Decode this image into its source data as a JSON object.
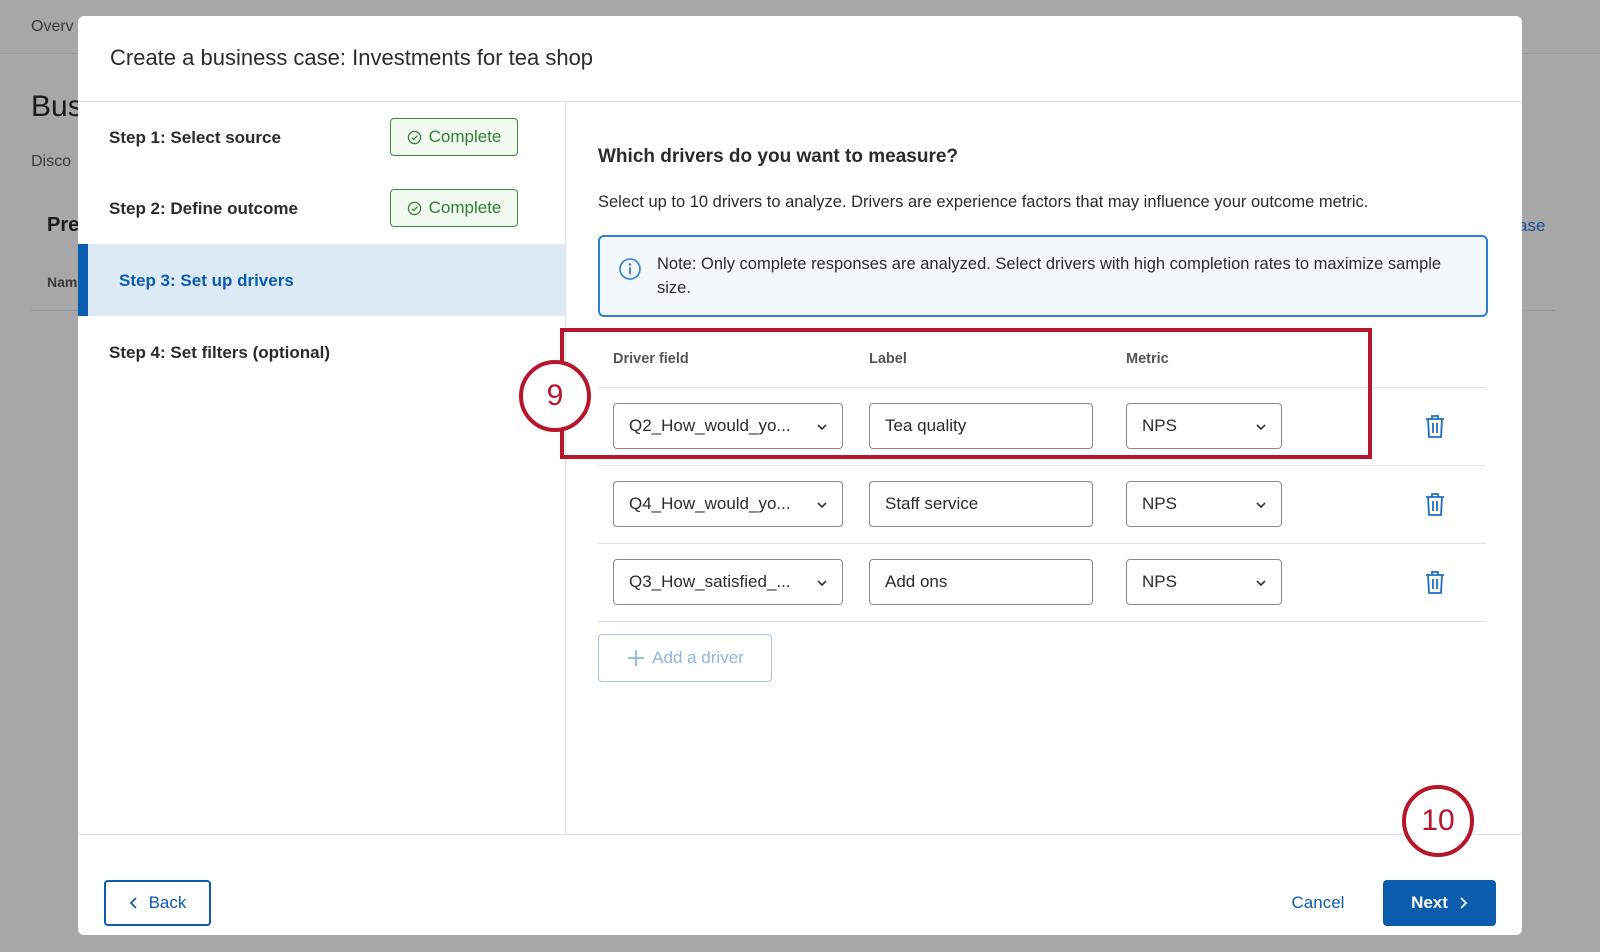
{
  "background": {
    "overview_tab": "Overv",
    "title": "Bus",
    "subtitle": "Disco",
    "section": "Pre",
    "column": "Nam",
    "link": "ase"
  },
  "modal": {
    "title": "Create a business case: Investments for tea shop",
    "steps": [
      {
        "label": "Step 1: Select source",
        "status": "Complete"
      },
      {
        "label": "Step 2: Define outcome",
        "status": "Complete"
      },
      {
        "label": "Step 3: Set up drivers",
        "status": "active"
      },
      {
        "label": "Step 4: Set filters (optional)",
        "status": ""
      }
    ],
    "question": "Which drivers do you want to measure?",
    "description": "Select up to 10 drivers to analyze. Drivers are experience factors that may influence your outcome metric.",
    "note": "Note: Only complete responses are analyzed. Select drivers with high completion rates to maximize sample size.",
    "table": {
      "headers": {
        "driver_field": "Driver field",
        "label": "Label",
        "metric": "Metric"
      },
      "rows": [
        {
          "driver_field": "Q2_How_would_yo...",
          "label": "Tea quality",
          "metric": "NPS"
        },
        {
          "driver_field": "Q4_How_would_yo...",
          "label": "Staff service",
          "metric": "NPS"
        },
        {
          "driver_field": "Q3_How_satisfied_...",
          "label": "Add ons",
          "metric": "NPS"
        }
      ]
    },
    "add_driver_label": "Add a driver",
    "footer": {
      "back_label": "Back",
      "cancel_label": "Cancel",
      "next_label": "Next"
    }
  },
  "annotations": {
    "marker_9": "9",
    "marker_10": "10"
  },
  "colors": {
    "accent": "#0b5cad",
    "complete": "#2e7d32",
    "annotation": "#b5162b",
    "note_border": "#2f7fd1"
  },
  "icons": [
    "check-circle-icon",
    "info-icon",
    "chevron-down-icon",
    "trash-icon",
    "plus-icon",
    "chevron-left-icon",
    "chevron-right-icon"
  ]
}
